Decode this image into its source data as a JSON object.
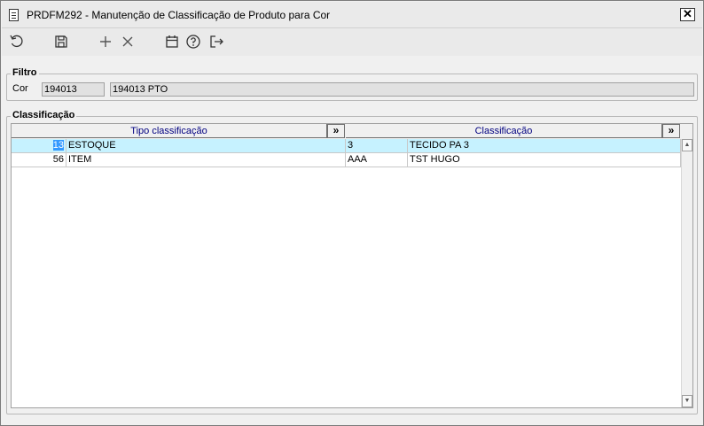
{
  "window": {
    "title": "PRDFM292 - Manutenção de Classificação de Produto para Cor",
    "close_label": "✕"
  },
  "toolbar": {
    "buttons": [
      {
        "name": "refresh",
        "icon": "refresh-icon"
      },
      {
        "name": "save",
        "icon": "save-icon"
      },
      {
        "name": "add",
        "icon": "plus-icon"
      },
      {
        "name": "delete",
        "icon": "close-icon"
      },
      {
        "name": "calendar",
        "icon": "calendar-icon"
      },
      {
        "name": "help",
        "icon": "help-icon"
      },
      {
        "name": "exit",
        "icon": "exit-icon"
      }
    ]
  },
  "filter": {
    "group_label": "Filtro",
    "cor_label": "Cor",
    "cor_code": "194013",
    "cor_description": "194013 PTO"
  },
  "classification": {
    "group_label": "Classificação",
    "columns": {
      "tipo": "Tipo classificação",
      "classificacao": "Classificação",
      "expand_label": "»"
    },
    "rows": [
      {
        "tipo_code": "13",
        "tipo_desc": "ESTOQUE",
        "class_code": "3",
        "class_desc": "TECIDO PA 3",
        "selected": true
      },
      {
        "tipo_code": "56",
        "tipo_desc": "ITEM",
        "class_code": "AAA",
        "class_desc": "TST HUGO",
        "selected": false
      }
    ]
  },
  "colors": {
    "selected_row": "#c6f2ff",
    "header_text": "#000080",
    "selection_highlight": "#3399ff"
  }
}
